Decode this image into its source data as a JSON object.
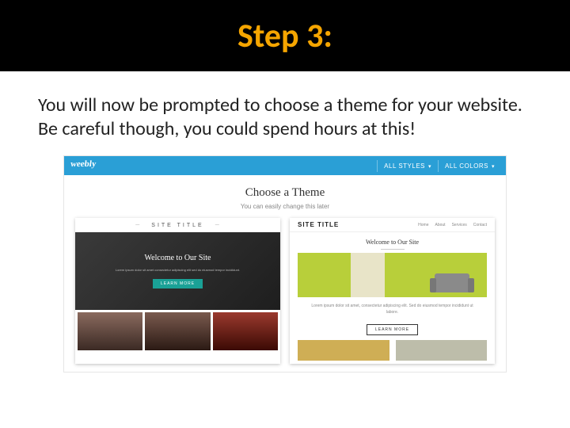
{
  "header": {
    "title": "Step 3:"
  },
  "body": {
    "text": "You will now be prompted to choose a theme for your website. Be careful though, you could spend hours at this!"
  },
  "mini": {
    "logo": "weebly",
    "filters": {
      "styles": "ALL STYLES",
      "colors": "ALL COLORS"
    },
    "hero": {
      "title": "Choose a Theme",
      "subtitle": "You can easily change this later"
    },
    "cardA": {
      "brand": "SITE TITLE",
      "welcome": "Welcome to Our Site",
      "cta": "LEARN MORE"
    },
    "cardB": {
      "brand": "SITE TITLE",
      "nav": [
        "Home",
        "About",
        "Services",
        "Contact"
      ],
      "title": "Welcome to Our Site",
      "cta": "LEARN MORE"
    }
  }
}
